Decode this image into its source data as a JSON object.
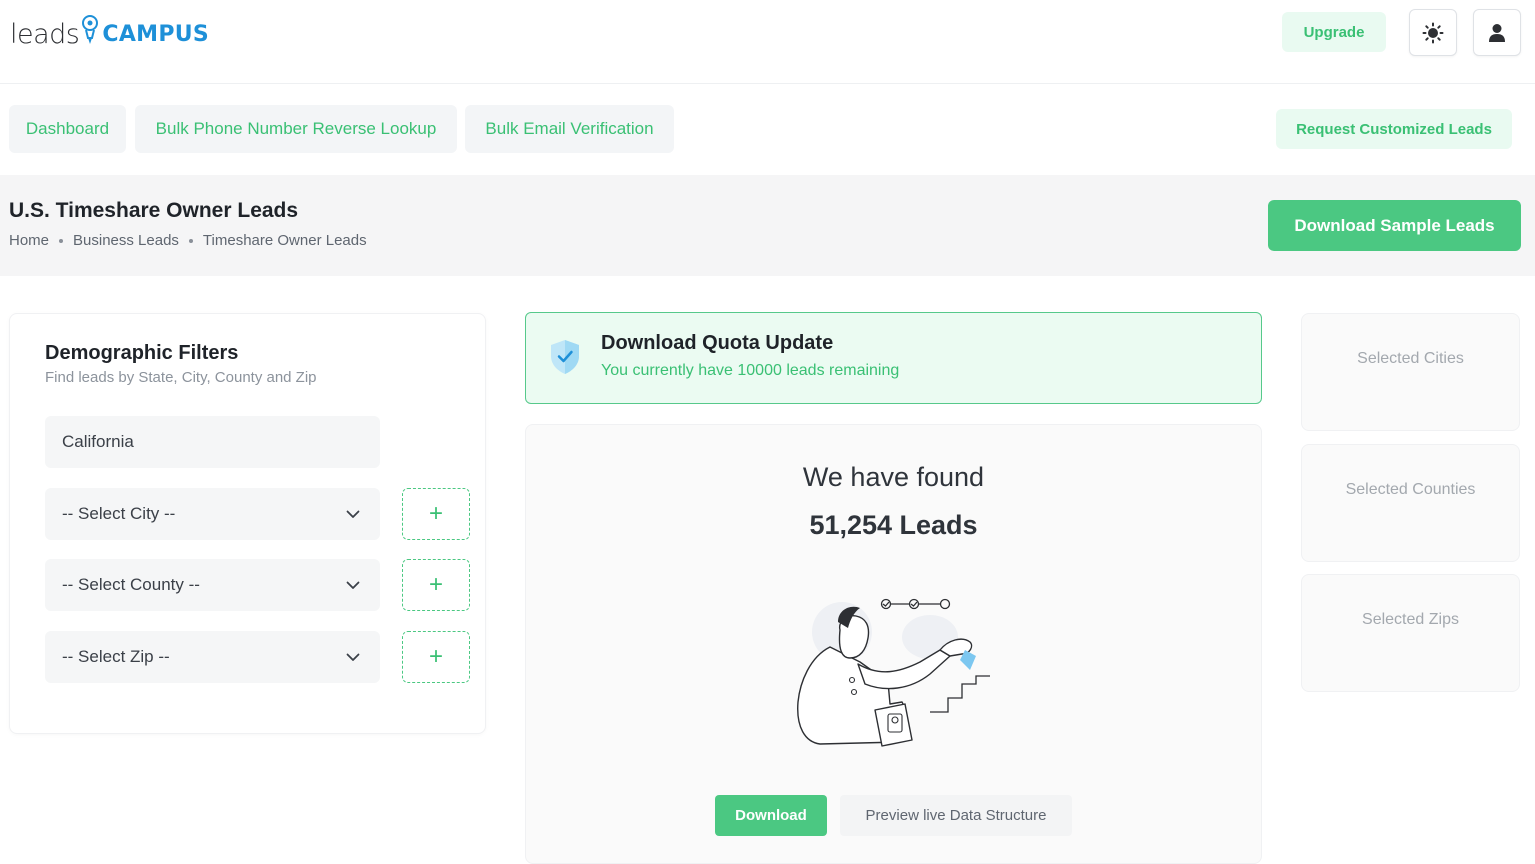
{
  "header": {
    "logo_text": "leads",
    "logo_brand": "CAMPUS",
    "upgrade_label": "Upgrade",
    "theme_icon": "sun-icon",
    "user_icon": "user-icon"
  },
  "nav": {
    "items": [
      {
        "label": "Dashboard"
      },
      {
        "label": "Bulk Phone Number Reverse Lookup"
      },
      {
        "label": "Bulk Email Verification"
      }
    ],
    "request_label": "Request Customized Leads"
  },
  "page": {
    "title": "U.S. Timeshare Owner Leads",
    "breadcrumb": [
      "Home",
      "Business Leads",
      "Timeshare Owner Leads"
    ],
    "download_sample_label": "Download Sample Leads"
  },
  "filters": {
    "title": "Demographic Filters",
    "subtitle": "Find leads by State, City, County and Zip",
    "state_value": "California",
    "city_placeholder": "-- Select City --",
    "county_placeholder": "-- Select County --",
    "zip_placeholder": "-- Select Zip --",
    "add_symbol": "+"
  },
  "quota": {
    "title": "Download Quota Update",
    "message": "You currently have 10000 leads remaining"
  },
  "results": {
    "found_label": "We have found",
    "count_text": "51,254 Leads",
    "download_label": "Download",
    "preview_label": "Preview live Data Structure"
  },
  "selected": {
    "cities_label": "Selected Cities",
    "counties_label": "Selected Counties",
    "zips_label": "Selected Zips"
  },
  "colors": {
    "accent": "#4bc882",
    "accent_text": "#3ac074",
    "brand_blue": "#1e90d8",
    "accent_light": "#ebfbf2"
  }
}
